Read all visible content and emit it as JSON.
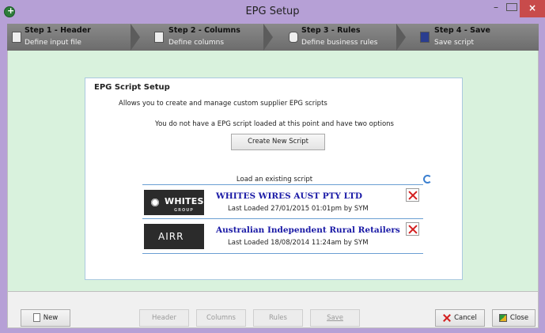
{
  "window": {
    "title": "EPG Setup",
    "controls": {
      "minimize": "–",
      "maximize": "",
      "close": "×"
    }
  },
  "steps": [
    {
      "title": "Step 1 - Header",
      "subtitle": "Define input file",
      "icon": "document-arrow-icon"
    },
    {
      "title": "Step 2 - Columns",
      "subtitle": "Define columns",
      "icon": "columns-icon"
    },
    {
      "title": "Step 3 - Rules",
      "subtitle": "Define business rules",
      "icon": "database-icon"
    },
    {
      "title": "Step 4 - Save",
      "subtitle": "Save script",
      "icon": "floppy-disk-icon"
    }
  ],
  "card": {
    "title": "EPG Script Setup",
    "description": "Allows you to create and manage custom supplier EPG scripts",
    "message": "You do not have a EPG script loaded at this point and have two options",
    "create_button": "Create New Script",
    "load_label": "Load an existing script"
  },
  "scripts": [
    {
      "logo_text": "WHITES",
      "logo_subtext": "GROUP",
      "name": "WHITES WIRES AUST PTY LTD",
      "last_loaded": "Last Loaded 27/01/2015 01:01pm by SYM"
    },
    {
      "logo_text": "AIRR",
      "name": "Australian Independent Rural Retailers",
      "last_loaded": "Last Loaded 18/08/2014 11:24am by SYM"
    }
  ],
  "bottom": {
    "new": "New",
    "header": "Header",
    "columns": "Columns",
    "rules": "Rules",
    "save": "Save",
    "cancel": "Cancel",
    "close": "Close"
  },
  "colors": {
    "frame": "#b6a0d6",
    "content_bg": "#d9f2dd",
    "link_blue": "#1a1aa6",
    "delete_red": "#d31f1f"
  }
}
